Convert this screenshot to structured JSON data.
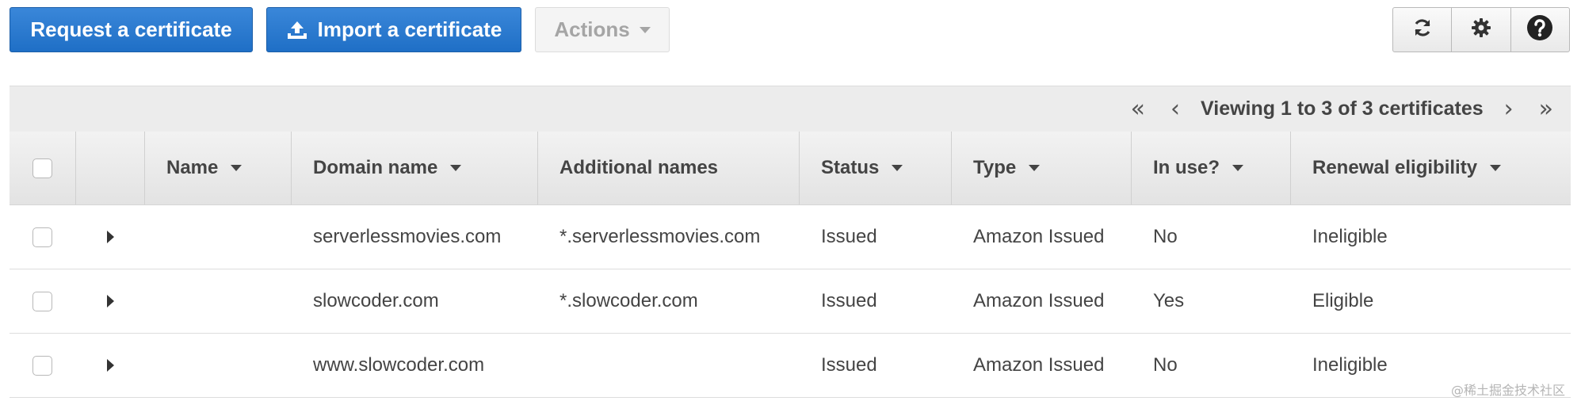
{
  "toolbar": {
    "request_label": "Request a certificate",
    "import_label": "Import a certificate",
    "actions_label": "Actions",
    "accent_color": "#1f6fc6"
  },
  "tools": {
    "refresh_icon": "refresh-icon",
    "settings_icon": "gear-icon",
    "help_icon": "help-icon"
  },
  "pager": {
    "first": "«",
    "prev": "‹",
    "text": "Viewing 1 to 3 of 3 certificates",
    "next": "›",
    "last": "»"
  },
  "table": {
    "columns": {
      "name": "Name",
      "domain": "Domain name",
      "additional": "Additional names",
      "status": "Status",
      "type": "Type",
      "in_use": "In use?",
      "renewal": "Renewal eligibility"
    },
    "rows": [
      {
        "name": "",
        "domain": "serverlessmovies.com",
        "additional": "*.serverlessmovies.com",
        "status": "Issued",
        "type": "Amazon Issued",
        "in_use": "No",
        "renewal": "Ineligible"
      },
      {
        "name": "",
        "domain": "slowcoder.com",
        "additional": "*.slowcoder.com",
        "status": "Issued",
        "type": "Amazon Issued",
        "in_use": "Yes",
        "renewal": "Eligible"
      },
      {
        "name": "",
        "domain": "www.slowcoder.com",
        "additional": "",
        "status": "Issued",
        "type": "Amazon Issued",
        "in_use": "No",
        "renewal": "Ineligible"
      }
    ]
  },
  "watermark": "@稀土掘金技术社区"
}
